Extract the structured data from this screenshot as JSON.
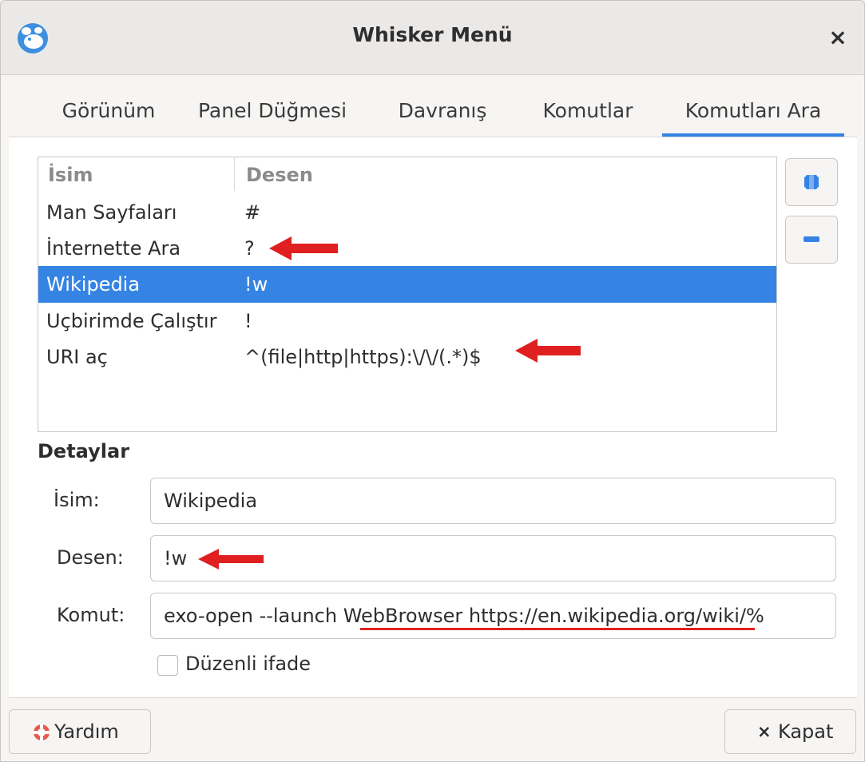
{
  "window": {
    "title": "Whisker Menü",
    "close_glyph": "×",
    "app_icon": "whisker-mouse-icon"
  },
  "tabs": [
    {
      "label": "Görünüm"
    },
    {
      "label": "Panel Düğmesi"
    },
    {
      "label": "Davranış"
    },
    {
      "label": "Komutlar"
    },
    {
      "label": "Komutları Ara",
      "active": true
    }
  ],
  "list": {
    "headers": {
      "name": "İsim",
      "pattern": "Desen"
    },
    "rows": [
      {
        "name": "Man Sayfaları",
        "pattern": "#"
      },
      {
        "name": "İnternette Ara",
        "pattern": "?"
      },
      {
        "name": "Wikipedia",
        "pattern": "!w",
        "selected": true
      },
      {
        "name": "Uçbirimde Çalıştır",
        "pattern": "!"
      },
      {
        "name": "URI aç",
        "pattern": "^(file|http|https):\\/\\/(.*)$"
      }
    ]
  },
  "side_buttons": {
    "add_icon": "plus-icon",
    "remove_icon": "minus-icon"
  },
  "details": {
    "title": "Detaylar",
    "name_label": "İsim:",
    "name_value": "Wikipedia",
    "pattern_label": "Desen:",
    "pattern_value": "!w",
    "command_label": "Komut:",
    "command_value": "exo-open --launch WebBrowser https://en.wikipedia.org/wiki/%",
    "regex_label": "Düzenli ifade",
    "regex_checked": false
  },
  "buttons": {
    "help": "Yardım",
    "close": "Kapat",
    "close_glyph": "×"
  },
  "colors": {
    "accent": "#3584e4",
    "annotation": "#e02020"
  }
}
